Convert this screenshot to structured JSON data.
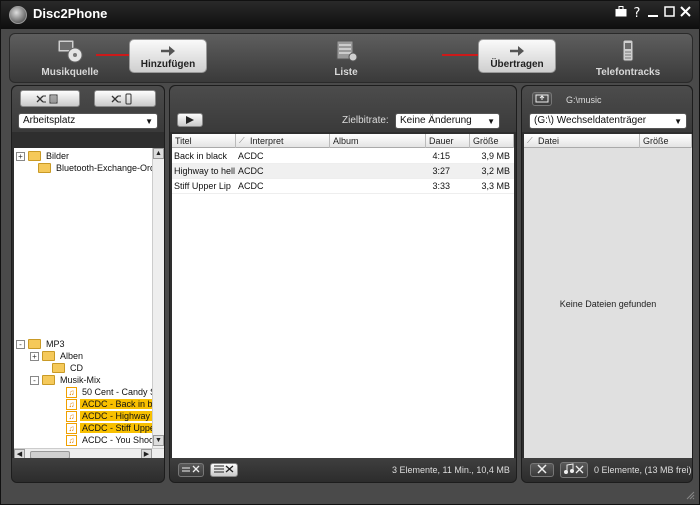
{
  "window": {
    "title": "Disc2Phone",
    "controls": [
      "⌂",
      "?",
      "–",
      "□",
      "✕"
    ]
  },
  "toolbar": {
    "source": "Musikquelle",
    "add": "Hinzufügen",
    "list": "Liste",
    "transfer": "Übertragen",
    "phone_tracks": "Telefontracks"
  },
  "left_panel": {
    "location": "Arbeitsplatz",
    "tree": [
      {
        "label": "Bilder",
        "kind": "folder",
        "expand": "+",
        "selected": false
      },
      {
        "label": "Bluetooth-Exchange-Ordn",
        "kind": "folder",
        "expand": "",
        "selected": false
      },
      {
        "label": "MP3",
        "kind": "folder",
        "expand": "-",
        "selected": false
      },
      {
        "label": "Alben",
        "kind": "folder",
        "expand": "+",
        "selected": false
      },
      {
        "label": "CD",
        "kind": "folder",
        "expand": "",
        "selected": false
      },
      {
        "label": "Musik-Mix",
        "kind": "folder",
        "expand": "-",
        "selected": false
      },
      {
        "label": "50 Cent - Candy S",
        "kind": "music",
        "expand": "",
        "selected": false
      },
      {
        "label": "ACDC - Back in b",
        "kind": "music",
        "expand": "",
        "selected": true
      },
      {
        "label": "ACDC - Highway",
        "kind": "music",
        "expand": "",
        "selected": true
      },
      {
        "label": "ACDC - Stiff Uppe",
        "kind": "music",
        "expand": "",
        "selected": true
      },
      {
        "label": "ACDC - You Shoo",
        "kind": "music",
        "expand": "",
        "selected": false
      }
    ]
  },
  "middle_panel": {
    "bitrate_label": "Zielbitrate:",
    "bitrate_value": "Keine Änderung",
    "columns": [
      "Titel",
      "Interpret",
      "Album",
      "Dauer",
      "Größe"
    ],
    "rows": [
      {
        "title": "Back in black",
        "artist": "ACDC",
        "album": "",
        "duration": "4:15",
        "size": "3,9 MB"
      },
      {
        "title": "Highway to hell",
        "artist": "ACDC",
        "album": "",
        "duration": "3:27",
        "size": "3,2 MB"
      },
      {
        "title": "Stiff Upper Lip",
        "artist": "ACDC",
        "album": "",
        "duration": "3:33",
        "size": "3,3 MB"
      }
    ],
    "status": "3 Elemente, 11 Min., 10,4 MB"
  },
  "right_panel": {
    "path": "G:\\music",
    "device": "(G:\\) Wechseldatenträger",
    "columns": [
      "Datei",
      "Größe"
    ],
    "empty_text": "Keine Dateien gefunden",
    "status": "0 Elemente, (13 MB frei)"
  }
}
